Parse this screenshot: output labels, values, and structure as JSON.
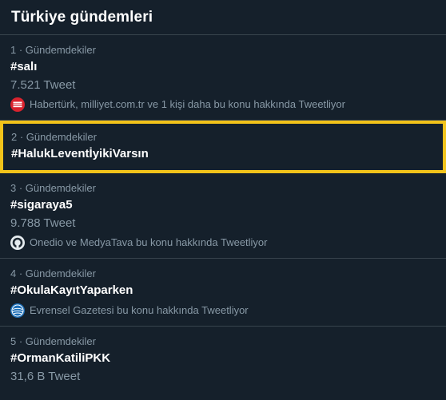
{
  "header": {
    "title": "Türkiye gündemleri"
  },
  "trends": [
    {
      "meta": "1 · Gündemdekiler",
      "tag": "#salı",
      "count": "7.521 Tweet",
      "context": "Habertürk, milliyet.com.tr ve 1 kişi daha bu konu hakkında Tweetliyor",
      "icon": "haberturk-logo-icon"
    },
    {
      "meta": "2 · Gündemdekiler",
      "tag": "#HalukLeventİyikiVarsın"
    },
    {
      "meta": "3 · Gündemdekiler",
      "tag": "#sigaraya5",
      "count": "9.788 Tweet",
      "context": "Onedio ve MedyaTava bu konu hakkında Tweetliyor",
      "icon": "onedio-logo-icon"
    },
    {
      "meta": "4 · Gündemdekiler",
      "tag": "#OkulaKayıtYaparken",
      "context": "Evrensel Gazetesi bu konu hakkında Tweetliyor",
      "icon": "evrensel-logo-icon"
    },
    {
      "meta": "5 · Gündemdekiler",
      "tag": "#OrmanKatiliPKK",
      "count": "31,6 B Tweet"
    }
  ],
  "colors": {
    "background": "#15202b",
    "divider": "#38444d",
    "secondary_text": "#8899a6",
    "highlight_border": "#f2c31a"
  }
}
